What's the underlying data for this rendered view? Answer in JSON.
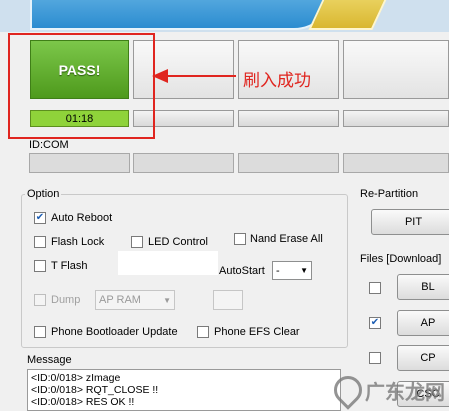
{
  "ports": {
    "status_label": "PASS!",
    "elapsed_time": "01:18",
    "id_com_label": "ID:COM"
  },
  "annotation": {
    "text": "刷入成功",
    "color": "#e0251f"
  },
  "option": {
    "title": "Option",
    "auto_reboot": {
      "label": "Auto Reboot",
      "checked": true
    },
    "flash_lock": {
      "label": "Flash Lock",
      "checked": false
    },
    "led_control": {
      "label": "LED Control",
      "checked": false
    },
    "nand_erase_all": {
      "label": "Nand Erase All",
      "checked": false
    },
    "t_flash": {
      "label": "T Flash",
      "checked": false
    },
    "autostart_label": "AutoStart",
    "autostart_value": "-",
    "dump": {
      "label": "Dump",
      "checked": false
    },
    "dump_target": "AP RAM",
    "phone_bootloader_update": {
      "label": "Phone Bootloader Update",
      "checked": false
    },
    "phone_efs_clear": {
      "label": "Phone EFS Clear",
      "checked": false
    }
  },
  "repartition": {
    "title": "Re-Partition",
    "pit_button": "PIT"
  },
  "files": {
    "title": "Files [Download]",
    "bl_button": "BL",
    "ap_button": "AP",
    "cp_button": "CP",
    "csc_button": "CSC"
  },
  "message": {
    "title": "Message",
    "lines": [
      "<ID:0/018> zImage",
      "<ID:0/018> RQT_CLOSE !!",
      "<ID:0/018> RES OK !!"
    ]
  },
  "watermark": {
    "text": "广东龙网"
  },
  "colors": {
    "pass_green": "#5aa826",
    "timer_green": "#8fd33a",
    "highlight_red": "#e0251f"
  }
}
